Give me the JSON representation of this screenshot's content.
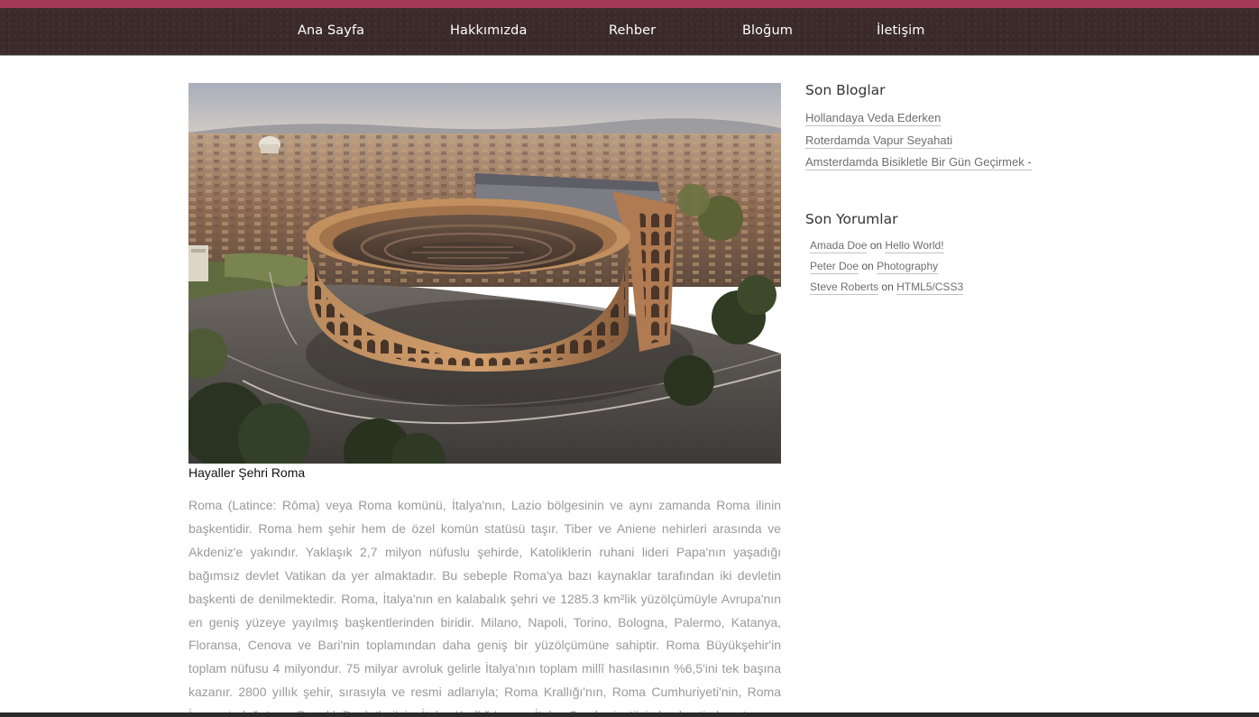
{
  "nav": {
    "items": [
      {
        "label": "Ana Sayfa"
      },
      {
        "label": "Hakkımızda"
      },
      {
        "label": "Rehber"
      },
      {
        "label": "Bloğum"
      },
      {
        "label": "İletişim"
      }
    ]
  },
  "colors": {
    "accent_stripe": "#a33a58",
    "nav_background": "#3b2a2a",
    "body_text": "#9a9a9a"
  },
  "article": {
    "image_subject": "aerial photo of the Colosseum in Rome",
    "caption": "Hayaller Şehri Roma",
    "body": "Roma (Latince: Rōma) veya Roma komünü, İtalya'nın, Lazio bölgesinin ve aynı zamanda Roma ilinin başkentidir. Roma hem şehir hem de özel komün statüsü taşır. Tiber ve Aniene nehirleri arasında ve Akdeniz'e yakındır. Yaklaşık 2,7 milyon nüfuslu şehirde, Katoliklerin ruhani lideri Papa'nın yaşadığı bağımsız devlet Vatikan da yer almaktadır. Bu sebeple Roma'ya bazı kaynaklar tarafından iki devletin başkenti de denilmektedir. Roma, İtalya'nın en kalabalık şehri ve 1285.3 km²lik yüzölçümüyle Avrupa'nın en geniş yüzeye yayılmış başkentlerinden biridir. Milano, Napoli, Torino, Bologna, Palermo, Katanya, Floransa, Cenova ve Bari'nin toplamından daha geniş bir yüzölçümüne sahiptir. Roma Büyükşehir'in toplam nüfusu 4 milyondur. 75 milyar avroluk gelirle İtalya'nın toplam millî hasılasının %6,5'ini tek başına kazanır. 2800 yıllık şehir, sırasıyla ve resmi adlarıyla; Roma Krallığı'nın, Roma Cumhuriyeti'nin, Roma İmparatorluğu'nun, Papalık Devletleri'nin, İtalya Krallığı'nın ve İtalya Cumhuriyeti'nin başkenti olmuştur."
  },
  "sidebar": {
    "recent_posts_title": "Son Bloglar",
    "recent_posts": [
      {
        "label": "Hollandaya Veda Ederken"
      },
      {
        "label": "Roterdamda Vapur Seyahati"
      },
      {
        "label": "Amsterdamda Bisikletle Bir Gün Geçirmek -"
      }
    ],
    "recent_comments_title": "Son Yorumlar",
    "comment_separator": "on",
    "recent_comments": [
      {
        "author": "Amada Doe",
        "post": "Hello World!"
      },
      {
        "author": "Peter Doe",
        "post": "Photography"
      },
      {
        "author": "Steve Roberts",
        "post": "HTML5/CSS3"
      }
    ]
  }
}
